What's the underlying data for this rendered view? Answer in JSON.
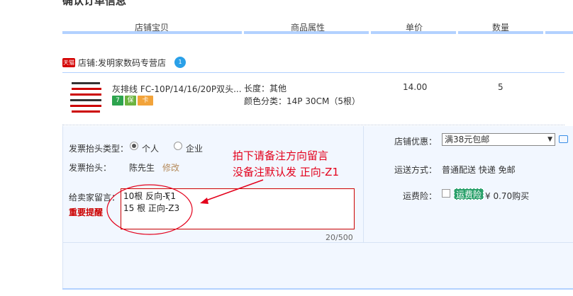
{
  "section": {
    "title": "确认订单信息"
  },
  "columns": [
    "店铺宝贝",
    "商品属性",
    "单价",
    "数量"
  ],
  "shop": {
    "label": "店铺:",
    "name": "发明家数码专营店",
    "tmall_badge": "天猫"
  },
  "item": {
    "title": "灰排线 FC-10P/14/16/20P双头...",
    "attr_length": "长度：其他",
    "attr_color": "颜色分类：14P 30CM（5根）",
    "price": "14.00",
    "quantity": "5",
    "badges": [
      "7",
      "保",
      "卡"
    ]
  },
  "invoice": {
    "type_label": "发票抬头类型：",
    "opt_personal": "个人",
    "opt_company": "企业",
    "title_label": "发票抬头：",
    "title_value": "陈先生",
    "modify_link": "修改"
  },
  "message": {
    "label": "给卖家留言：",
    "warning": "重要提醒",
    "text": "10根 反向-F1\n15 根 正向-Z3",
    "counter": "20/500"
  },
  "shop_discount": {
    "label": "店铺优惠：",
    "value": "满38元包邮"
  },
  "shipping": {
    "label": "运送方式：",
    "value": "普通配送 快递 免邮"
  },
  "insurance": {
    "label": "运费险：",
    "tag": "运费险",
    "price": "¥ 0.70购买"
  },
  "annotation": {
    "line1": "拍下请备注方向留言",
    "line2": "没备注默认发 正向-Z1"
  },
  "colors": {
    "accent_bar": "#b2d1ff",
    "annotation_red": "#e3001b",
    "panel_bg": "#f2f7ff"
  }
}
